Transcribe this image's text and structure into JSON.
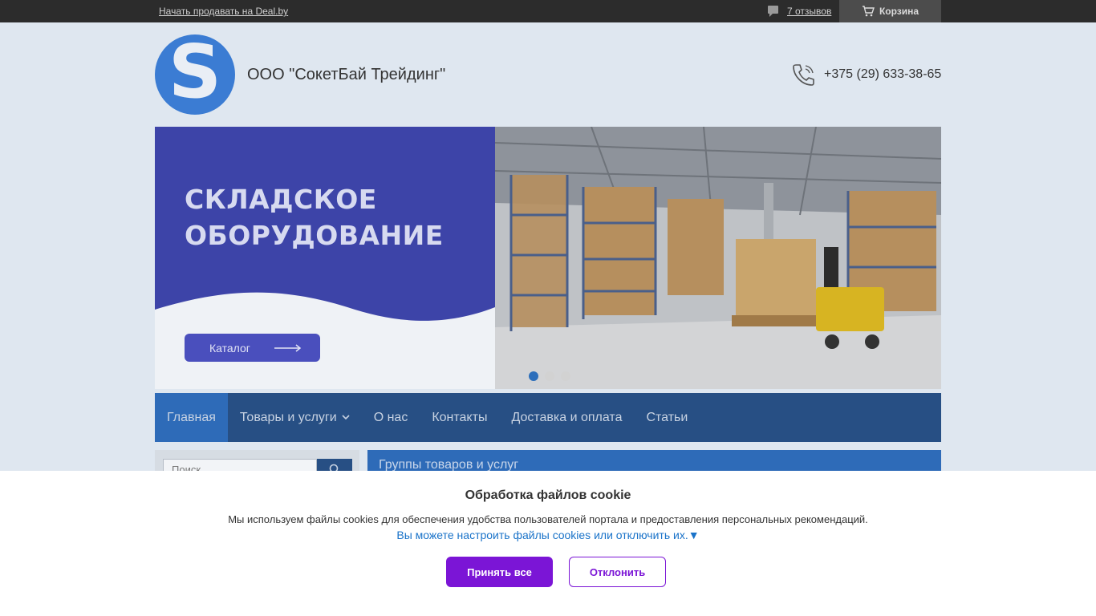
{
  "topbar": {
    "sell_link": "Начать продавать на Deal.by",
    "reviews_link": "7 отзывов",
    "cart_label": "Корзина"
  },
  "header": {
    "logo_letter": "S",
    "company_name": "ООО \"СокетБай Трейдинг\"",
    "phone": "+375 (29) 633-38-65"
  },
  "banner": {
    "headline_line1": "СКЛАДСКОЕ",
    "headline_line2": "ОБОРУДОВАНИЕ",
    "catalog_button": "Каталог",
    "slides": 3,
    "active_slide": 1
  },
  "nav": {
    "items": [
      {
        "label": "Главная",
        "active": true
      },
      {
        "label": "Товары и услуги",
        "dropdown": true
      },
      {
        "label": "О нас"
      },
      {
        "label": "Контакты"
      },
      {
        "label": "Доставка и оплата"
      },
      {
        "label": "Статьи"
      }
    ]
  },
  "sidebar": {
    "search_placeholder": "Поиск"
  },
  "content": {
    "groups_title": "Группы товаров и услуг"
  },
  "cookie": {
    "title": "Обработка файлов cookie",
    "text": "Мы используем файлы cookies для обеспечения удобства пользователей портала и предоставления персональных рекомендаций.",
    "settings_link": "Вы можете настроить файлы cookies или отключить их.",
    "accept_label": "Принять все",
    "decline_label": "Отклонить"
  },
  "colors": {
    "accent": "#2e6bb8",
    "nav_bg": "#274f84",
    "cookie_button": "#7b15d6",
    "topbar_bg": "#2c2c2c"
  }
}
